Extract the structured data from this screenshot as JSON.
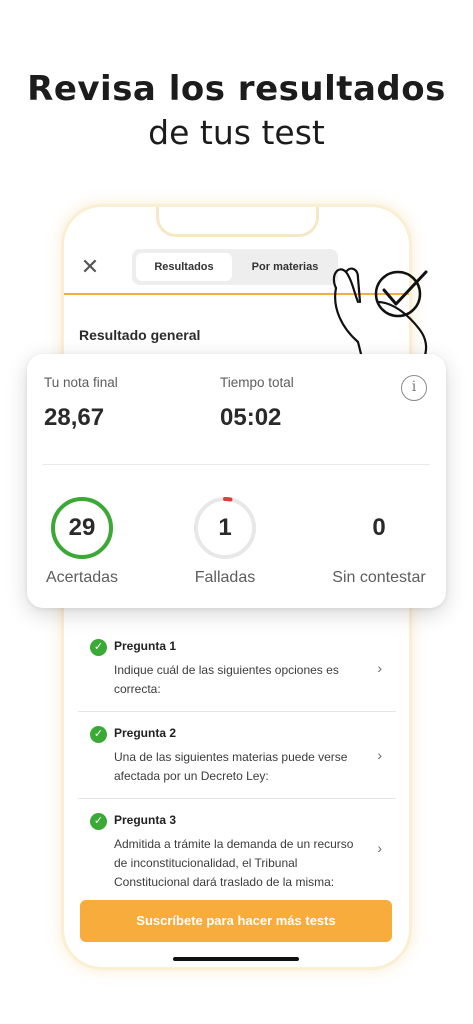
{
  "headline": {
    "line1": "Revisa los resultados",
    "line2": "de tus test"
  },
  "app": {
    "close_icon": "close-icon",
    "tabs": [
      {
        "label": "Resultados",
        "active": true
      },
      {
        "label": "Por materias",
        "active": false
      }
    ],
    "section_title": "Resultado general"
  },
  "summary": {
    "final_grade_label": "Tu nota final",
    "final_grade_value": "28,67",
    "time_label": "Tiempo total",
    "time_value": "05:02",
    "info_icon": "info-icon",
    "stats": [
      {
        "value": "29",
        "label": "Acertadas",
        "color": "#3aa935",
        "progress": 1.0
      },
      {
        "value": "1",
        "label": "Falladas",
        "color": "#e23b3b",
        "progress": 0.03
      },
      {
        "value": "0",
        "label": "Sin contestar"
      }
    ]
  },
  "questions": [
    {
      "title": "Pregunta 1",
      "text": "Indique cuál de las siguientes opciones es correcta:",
      "status": "correct"
    },
    {
      "title": "Pregunta 2",
      "text": "Una de las siguientes materias puede verse afectada por un Decreto Ley:",
      "status": "correct"
    },
    {
      "title": "Pregunta 3",
      "text": "Admitida a trámite la demanda de un recurso de inconstitucionalidad, el Tribunal Constitucional dará traslado de la misma:",
      "status": "correct"
    }
  ],
  "cta": {
    "label": "Suscríbete para hacer más tests"
  },
  "colors": {
    "accent": "#f7ac3c",
    "correct": "#3aa935",
    "wrong": "#e23b3b"
  }
}
